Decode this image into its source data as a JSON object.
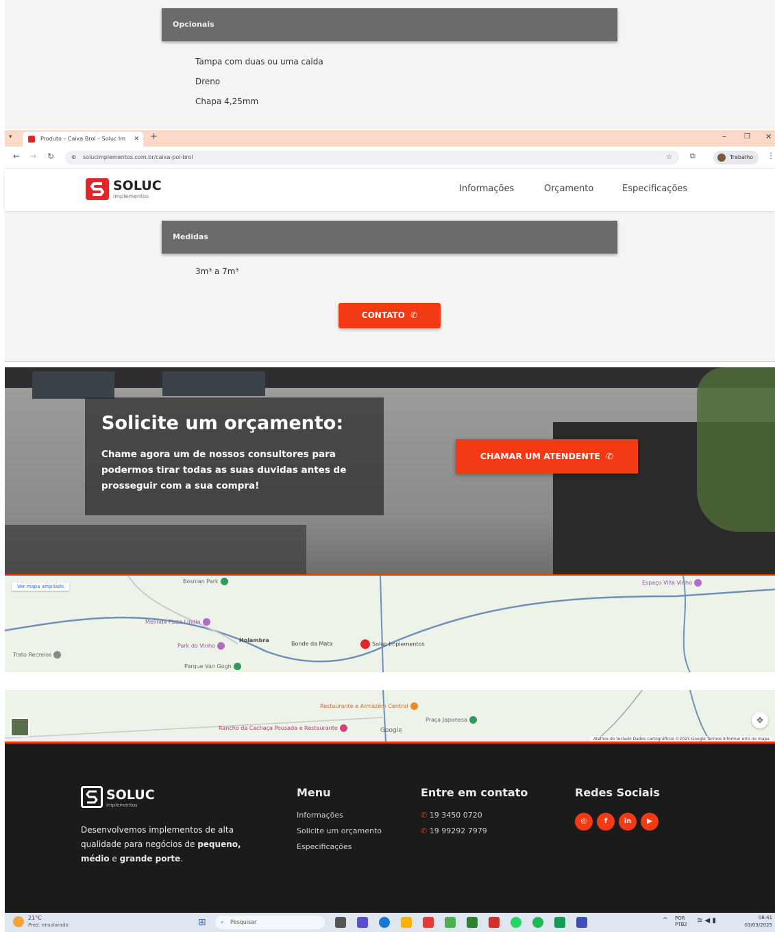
{
  "top_panel": {
    "header": "Opcionais",
    "items": [
      "Tampa com duas ou uma calda",
      "Dreno",
      "Chapa 4,25mm"
    ]
  },
  "browser": {
    "tab_title": "Produto – Caixa Brol – Soluc Im",
    "url": "solucimplementos.com.br/caixa-pol-brol",
    "profile_label": "Trabalho",
    "colors": {
      "tabbar": "#fbd8c8"
    }
  },
  "site": {
    "logo_text": "SOLUC",
    "logo_sub": "implementos",
    "nav": [
      "Informações",
      "Orçamento",
      "Especificações"
    ]
  },
  "medidas": {
    "header": "Medidas",
    "value": "3m³ a 7m³",
    "button_label": "CONTATO"
  },
  "hero": {
    "title": "Solicite um orçamento:",
    "text": "Chame agora um de nossos consultores para podermos tirar todas as suas duvidas antes de prosseguir com a sua compra!",
    "cta_label": "CHAMAR UM ATENDENTE"
  },
  "map": {
    "view_larger": "Ver mapa ampliado",
    "places_top": [
      {
        "name": "Bosnian Park"
      },
      {
        "name": "Melinda Pizza Lindia"
      },
      {
        "name": "Park do Vinho"
      },
      {
        "name": "Parque Van Gogh"
      },
      {
        "name": "Soluc Implementos"
      },
      {
        "name": "Bonde da Mata"
      },
      {
        "name": "Holambra"
      },
      {
        "name": "Espaço Villa Vinho"
      },
      {
        "name": "Trato Recreios"
      }
    ],
    "places_bottom": [
      {
        "name": "Restaurante e Armazém Central"
      },
      {
        "name": "Rancho da Cachaça Pousada e Restaurante"
      },
      {
        "name": "Praça Japonesa"
      },
      {
        "name": "Google"
      }
    ],
    "attribution": "Atalhos do teclado   Dados cartográficos ©2025 Google   Termos   Informar erro no mapa"
  },
  "footer": {
    "logo_text": "SOLUC",
    "logo_sub": "implementos",
    "description_1": "Desenvolvemos implementos de alta qualidade para negócios de ",
    "description_bold_1": "pequeno,",
    "description_bold_2": "médio",
    "description_mid": " e ",
    "description_bold_3": "grande porte",
    "description_end": ".",
    "menu_title": "Menu",
    "menu_links": [
      "Informações",
      "Solicite um orçamento",
      "Especificações"
    ],
    "contact_title": "Entre em contato",
    "phones": [
      "19 3450 0720",
      "19 99292 7979"
    ],
    "social_title": "Redes Sociais",
    "social": [
      "instagram-icon",
      "facebook-icon",
      "linkedin-icon",
      "youtube-icon"
    ],
    "accent": "#f23a14"
  },
  "taskbar": {
    "weather_temp": "21°C",
    "weather_desc": "Pred. ensolarado",
    "search_placeholder": "Pesquisar",
    "lang": "POR\nPTB2",
    "time": "08:41",
    "date": "03/03/2025"
  }
}
